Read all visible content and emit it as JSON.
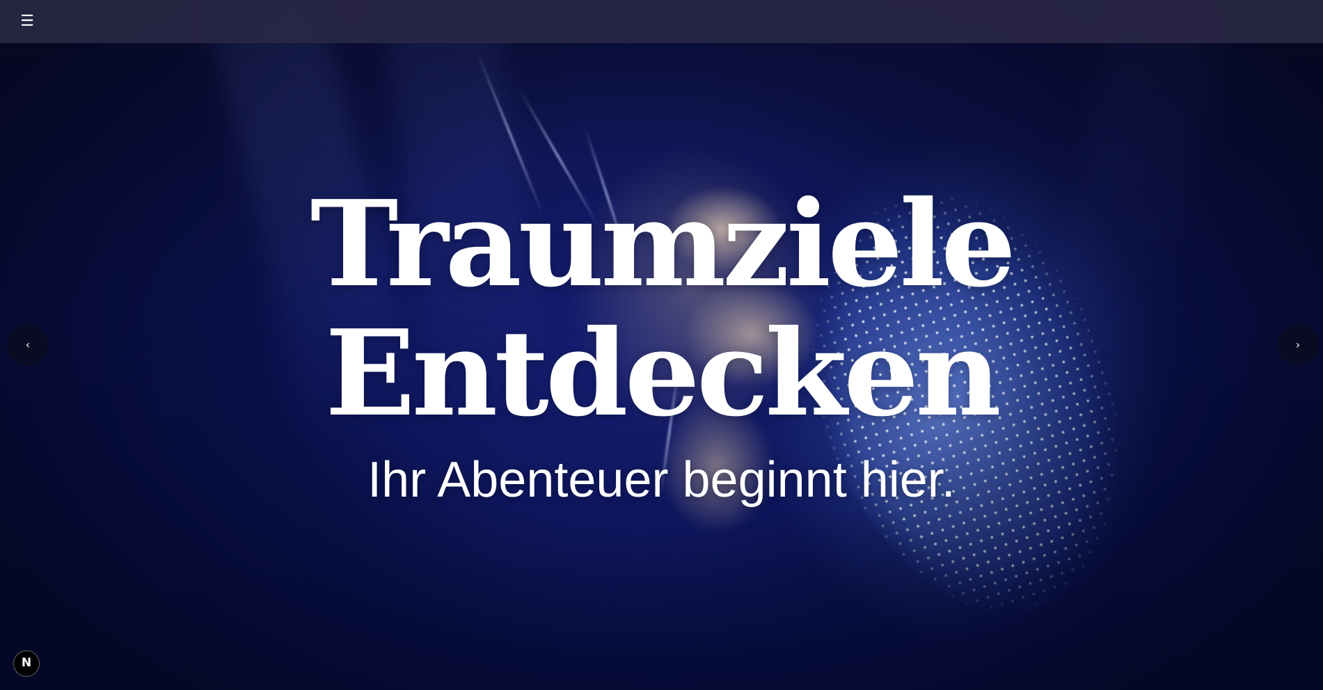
{
  "header": {
    "menu_icon": "hamburger-icon",
    "menu_glyph": "☰"
  },
  "hero": {
    "title_line1": "Traumziele",
    "title_line2": "Entdecken",
    "subtitle": "Ihr Abenteuer beginnt hier.",
    "background": "jellyfish-photo"
  },
  "carousel": {
    "prev_glyph": "‹",
    "next_glyph": "›",
    "prev_icon": "chevron-left-icon",
    "next_icon": "chevron-right-icon"
  },
  "badge": {
    "letter": "N",
    "icon": "nextjs-logo-icon"
  },
  "colors": {
    "header_bg": "#2a2846",
    "text": "#ffffff",
    "background": "#0a1252"
  }
}
